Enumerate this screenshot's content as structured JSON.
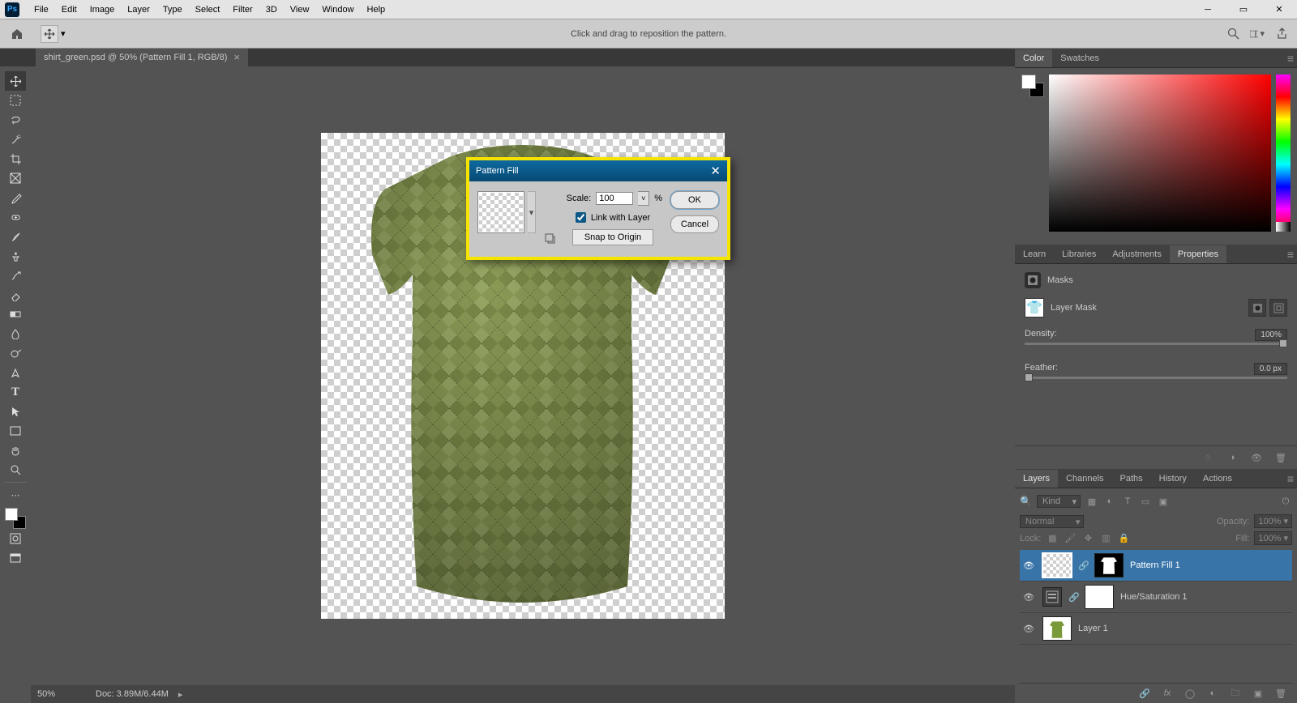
{
  "menubar": {
    "logo": "Ps",
    "items": [
      "File",
      "Edit",
      "Image",
      "Layer",
      "Type",
      "Select",
      "Filter",
      "3D",
      "View",
      "Window",
      "Help"
    ]
  },
  "optionsbar": {
    "hint": "Click and drag to reposition the pattern."
  },
  "document": {
    "tab_title": "shirt_green.psd @ 50% (Pattern Fill 1, RGB/8)"
  },
  "status": {
    "zoom": "50%",
    "doc": "Doc: 3.89M/6.44M"
  },
  "panels": {
    "color_tabs": [
      "Color",
      "Swatches"
    ],
    "mid_tabs": [
      "Learn",
      "Libraries",
      "Adjustments",
      "Properties"
    ],
    "lower_tabs": [
      "Layers",
      "Channels",
      "Paths",
      "History",
      "Actions"
    ]
  },
  "properties": {
    "section": "Masks",
    "label": "Layer Mask",
    "density_label": "Density:",
    "density_value": "100%",
    "feather_label": "Feather:",
    "feather_value": "0.0 px"
  },
  "layers": {
    "kind": "Kind",
    "blend_label": "Normal",
    "opacity_label": "Opacity:",
    "opacity_value": "100%",
    "lock_label": "Lock:",
    "fill_label": "Fill:",
    "fill_value": "100%",
    "rows": [
      {
        "name": "Pattern Fill 1",
        "active": true,
        "type": "pattern"
      },
      {
        "name": "Hue/Saturation 1",
        "active": false,
        "type": "adjust"
      },
      {
        "name": "Layer 1",
        "active": false,
        "type": "image"
      }
    ]
  },
  "dialog": {
    "title": "Pattern Fill",
    "scale_label": "Scale:",
    "scale_value": "100",
    "scale_unit": "%",
    "link_label": "Link with Layer",
    "snap_label": "Snap to Origin",
    "ok": "OK",
    "cancel": "Cancel"
  }
}
